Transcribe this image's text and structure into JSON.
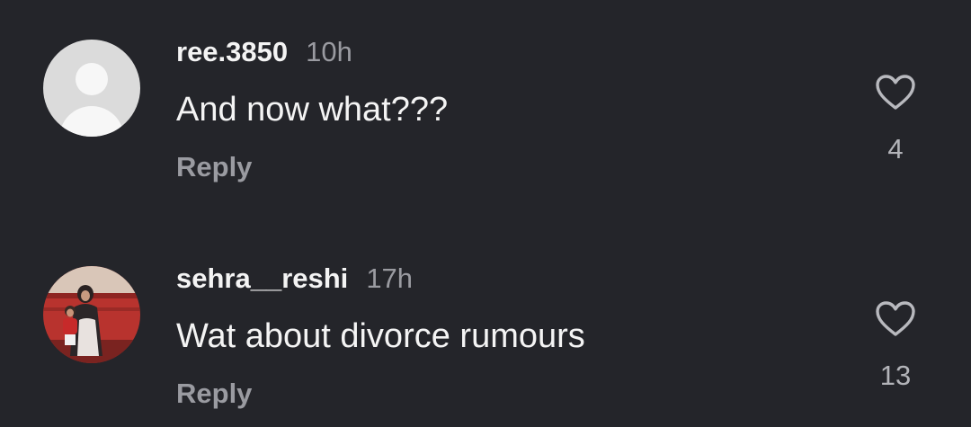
{
  "comments": [
    {
      "username": "ree.3850",
      "time": "10h",
      "text": "And now what???",
      "reply_label": "Reply",
      "like_count": "4",
      "avatar": "default-avatar-icon"
    },
    {
      "username": "sehra__reshi",
      "time": "17h",
      "text": "Wat about divorce rumours",
      "reply_label": "Reply",
      "like_count": "13",
      "avatar": "photo-avatar"
    }
  ],
  "icons": {
    "like": "heart-outline-icon"
  },
  "colors": {
    "background": "#24252a",
    "primary_text": "#f4f4f4",
    "secondary_text": "#9a9ba1"
  }
}
